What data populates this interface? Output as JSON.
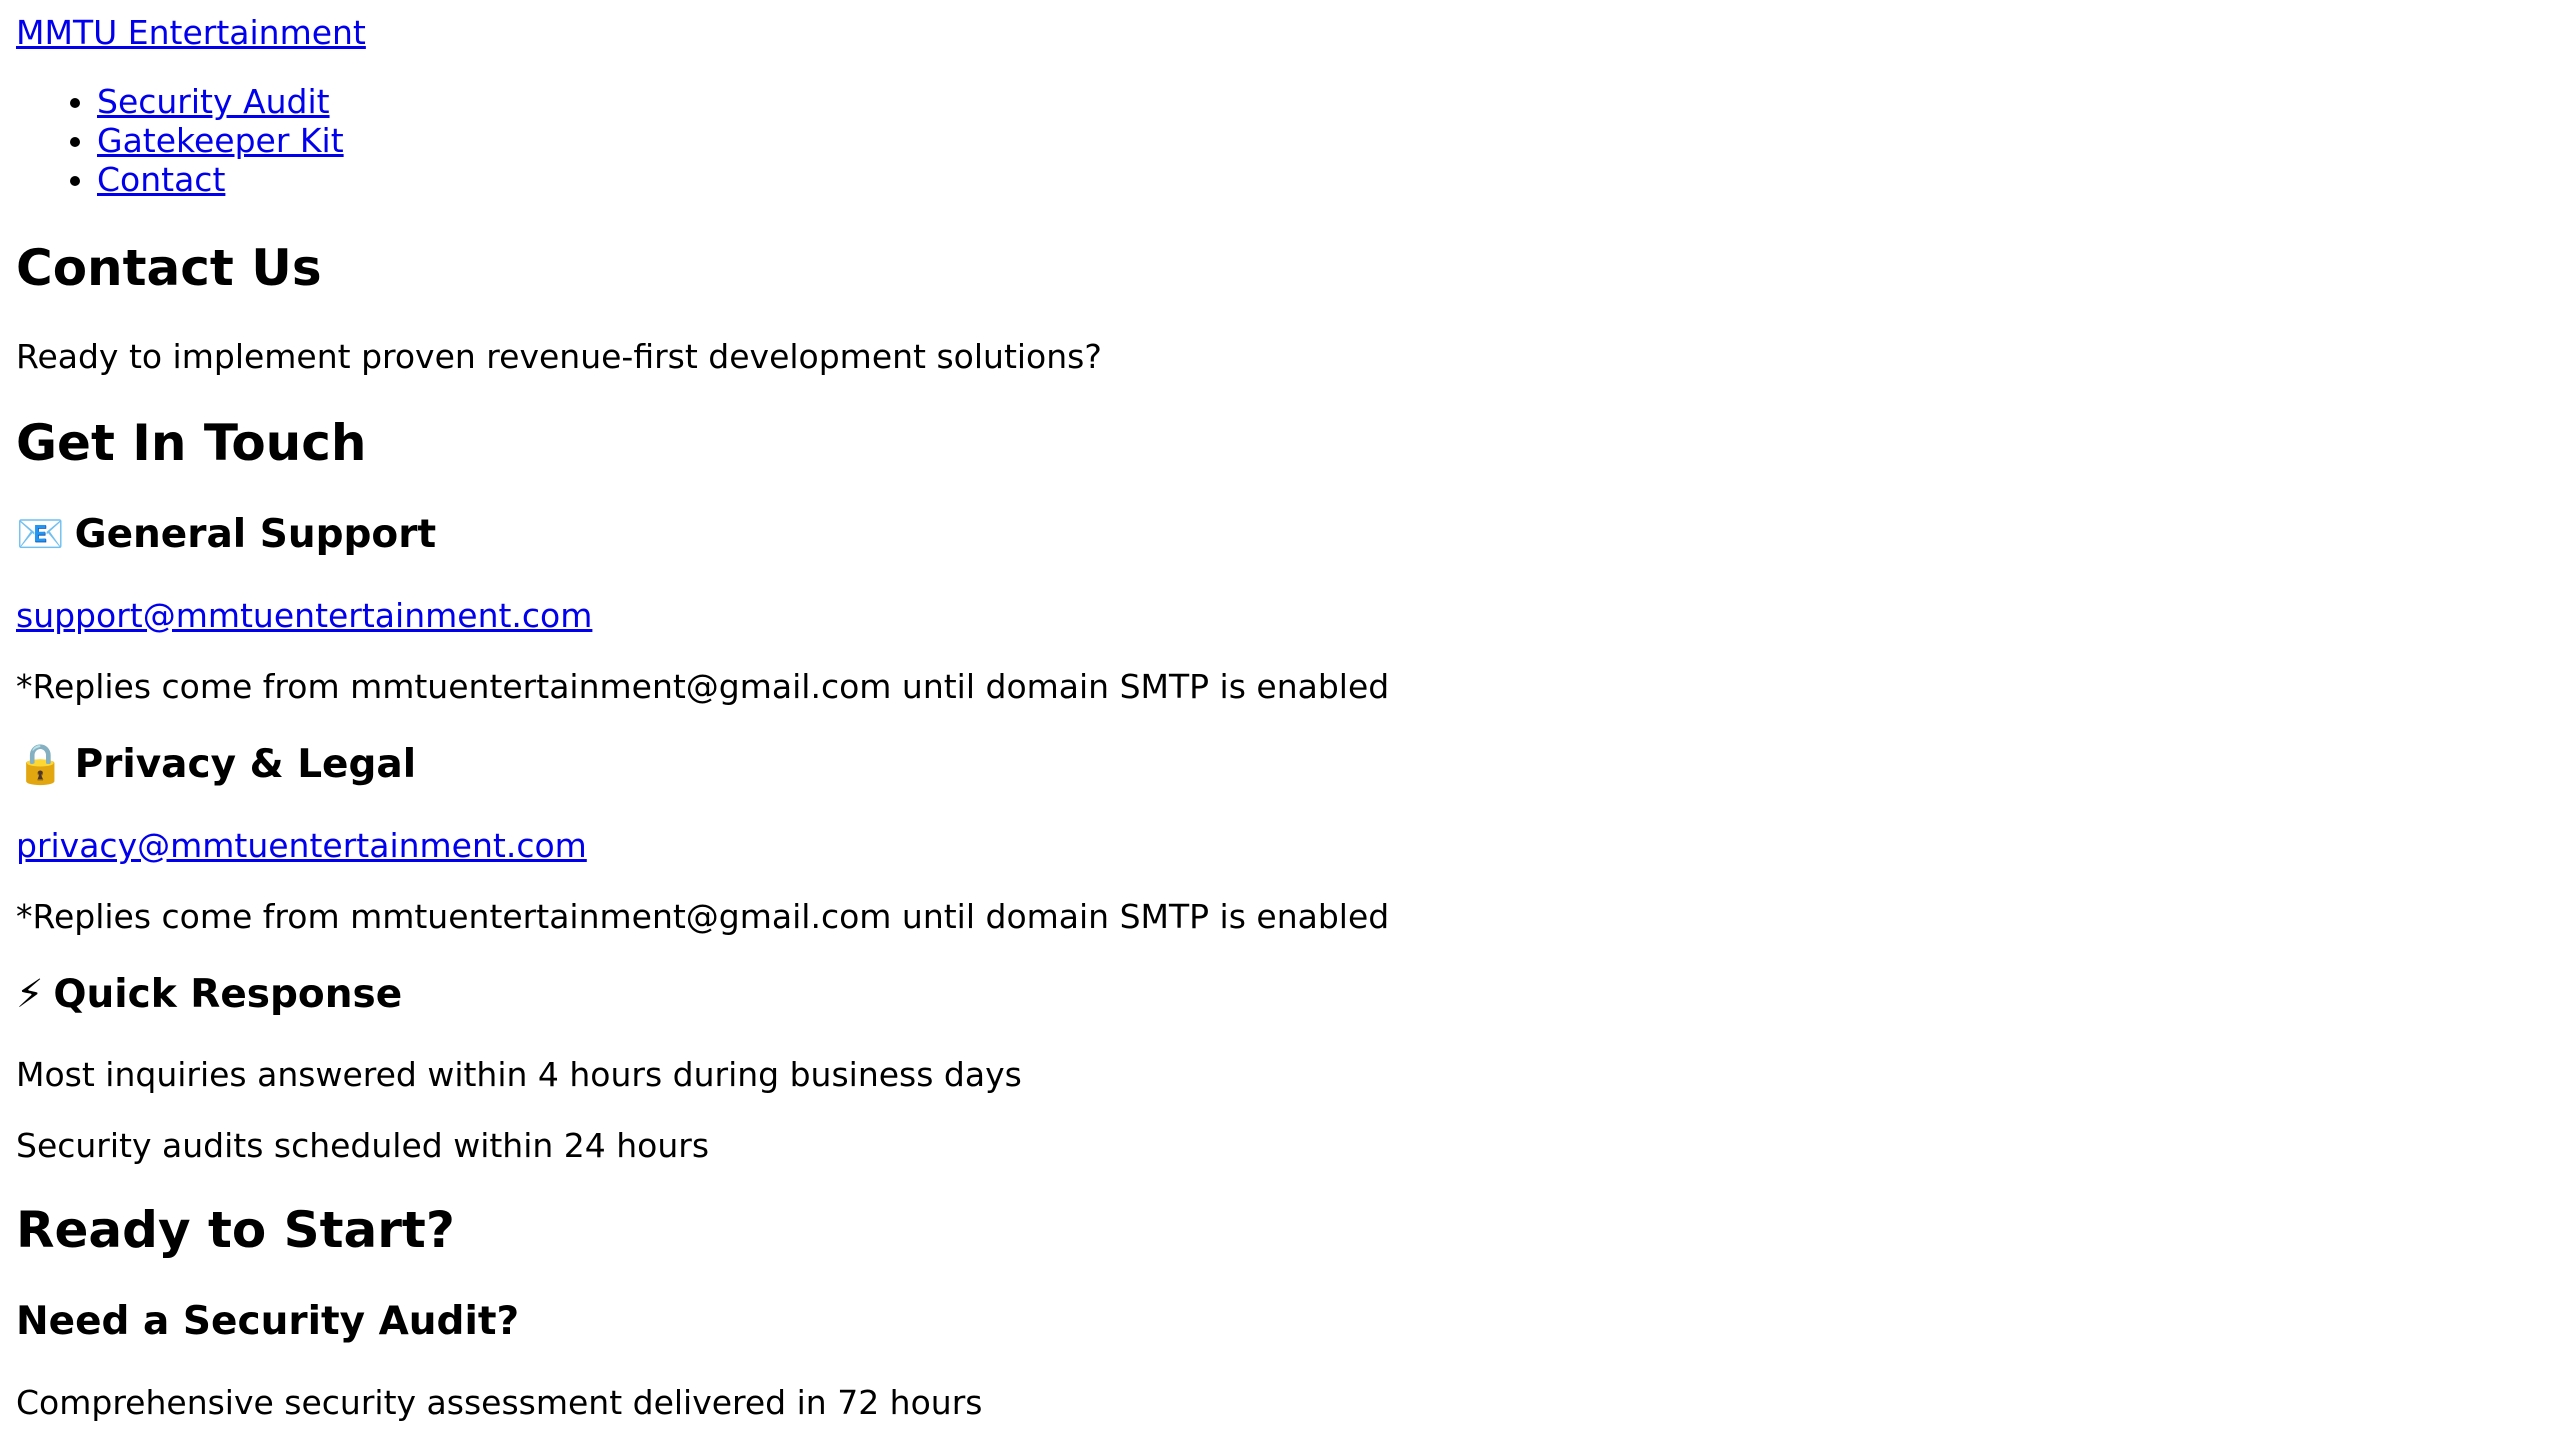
{
  "brand": {
    "label": "MMTU Entertainment"
  },
  "nav": {
    "items": [
      {
        "label": "Security Audit"
      },
      {
        "label": "Gatekeeper Kit"
      },
      {
        "label": "Contact"
      }
    ]
  },
  "hero": {
    "title": "Contact Us",
    "subtitle": "Ready to implement proven revenue-first development solutions?"
  },
  "contact": {
    "title": "Get In Touch",
    "general": {
      "icon": "📧",
      "heading": "General Support",
      "email": "support@mmtuentertainment.com",
      "note": "*Replies come from mmtuentertainment@gmail.com until domain SMTP is enabled"
    },
    "privacy": {
      "icon": "🔒",
      "heading": "Privacy & Legal",
      "email": "privacy@mmtuentertainment.com",
      "note": "*Replies come from mmtuentertainment@gmail.com until domain SMTP is enabled"
    },
    "quick": {
      "icon": "⚡",
      "heading": "Quick Response",
      "line1": "Most inquiries answered within 4 hours during business days",
      "line2": "Security audits scheduled within 24 hours"
    }
  },
  "start": {
    "title": "Ready to Start?",
    "audit_heading": "Need a Security Audit?",
    "audit_text": "Comprehensive security assessment delivered in 72 hours"
  }
}
